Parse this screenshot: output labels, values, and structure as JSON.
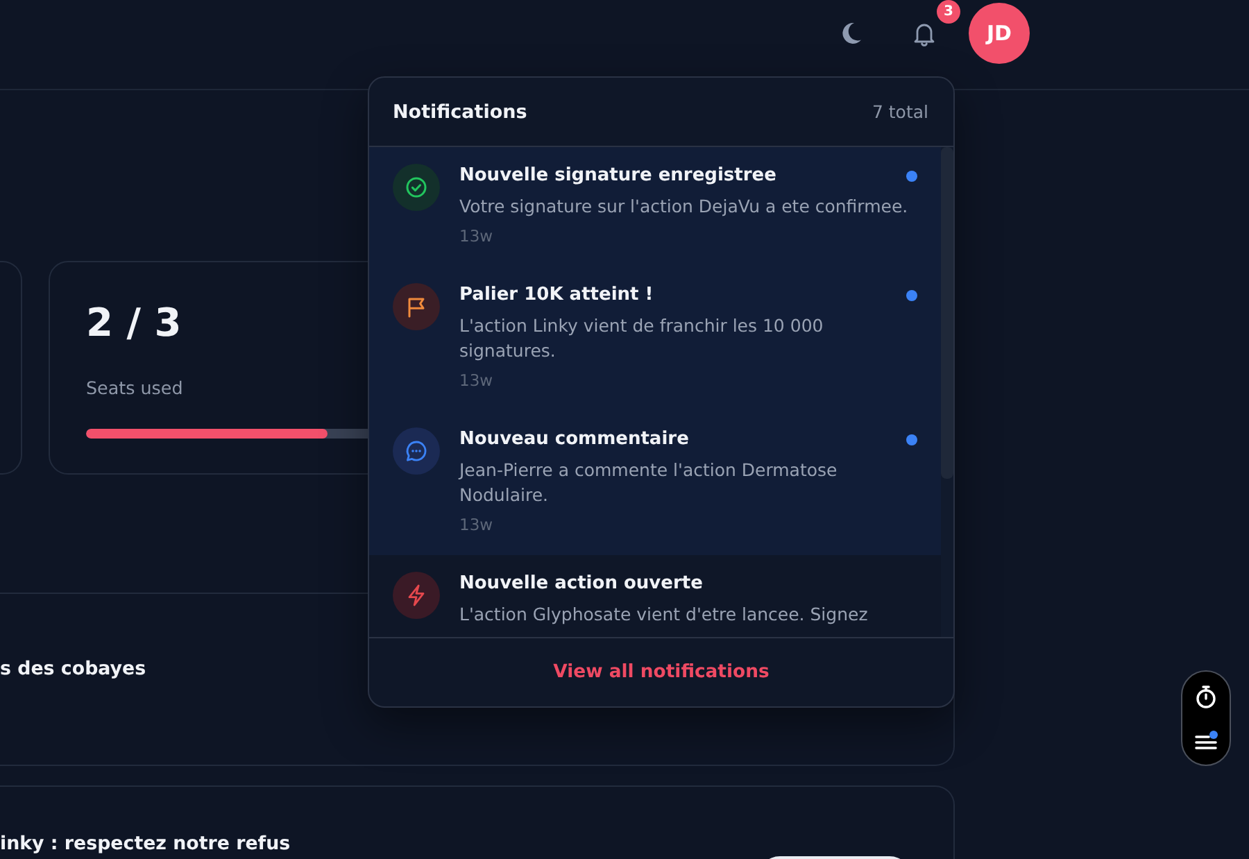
{
  "header": {
    "notification_count": "3",
    "avatar_initials": "JD"
  },
  "stats": [
    {
      "value": "2 / 3",
      "label": "Seats used",
      "level": 0.67
    }
  ],
  "sections": [
    {
      "title": "s des cobayes"
    },
    {
      "title": "inky : respectez notre refus",
      "has_button": true
    }
  ],
  "notifications": {
    "title": "Notifications",
    "total": "7 total",
    "items": [
      {
        "kind": "signature",
        "title": "Nouvelle signature enregistree",
        "text": "Votre signature sur l'action DejaVu a ete confirmee.",
        "time": "13w",
        "unread": true
      },
      {
        "kind": "milestone",
        "title": "Palier 10K atteint !",
        "text": "L'action Linky vient de franchir les 10 000 signatures.",
        "time": "13w",
        "unread": true
      },
      {
        "kind": "comment",
        "title": "Nouveau commentaire",
        "text": "Jean-Pierre a commente l'action Dermatose Nodulaire.",
        "time": "13w",
        "unread": true
      },
      {
        "kind": "action",
        "title": "Nouvelle action ouverte",
        "text": "L'action Glyphosate vient d'etre lancee. Signez",
        "unread": false
      }
    ],
    "view_all": "View all notifications"
  }
}
